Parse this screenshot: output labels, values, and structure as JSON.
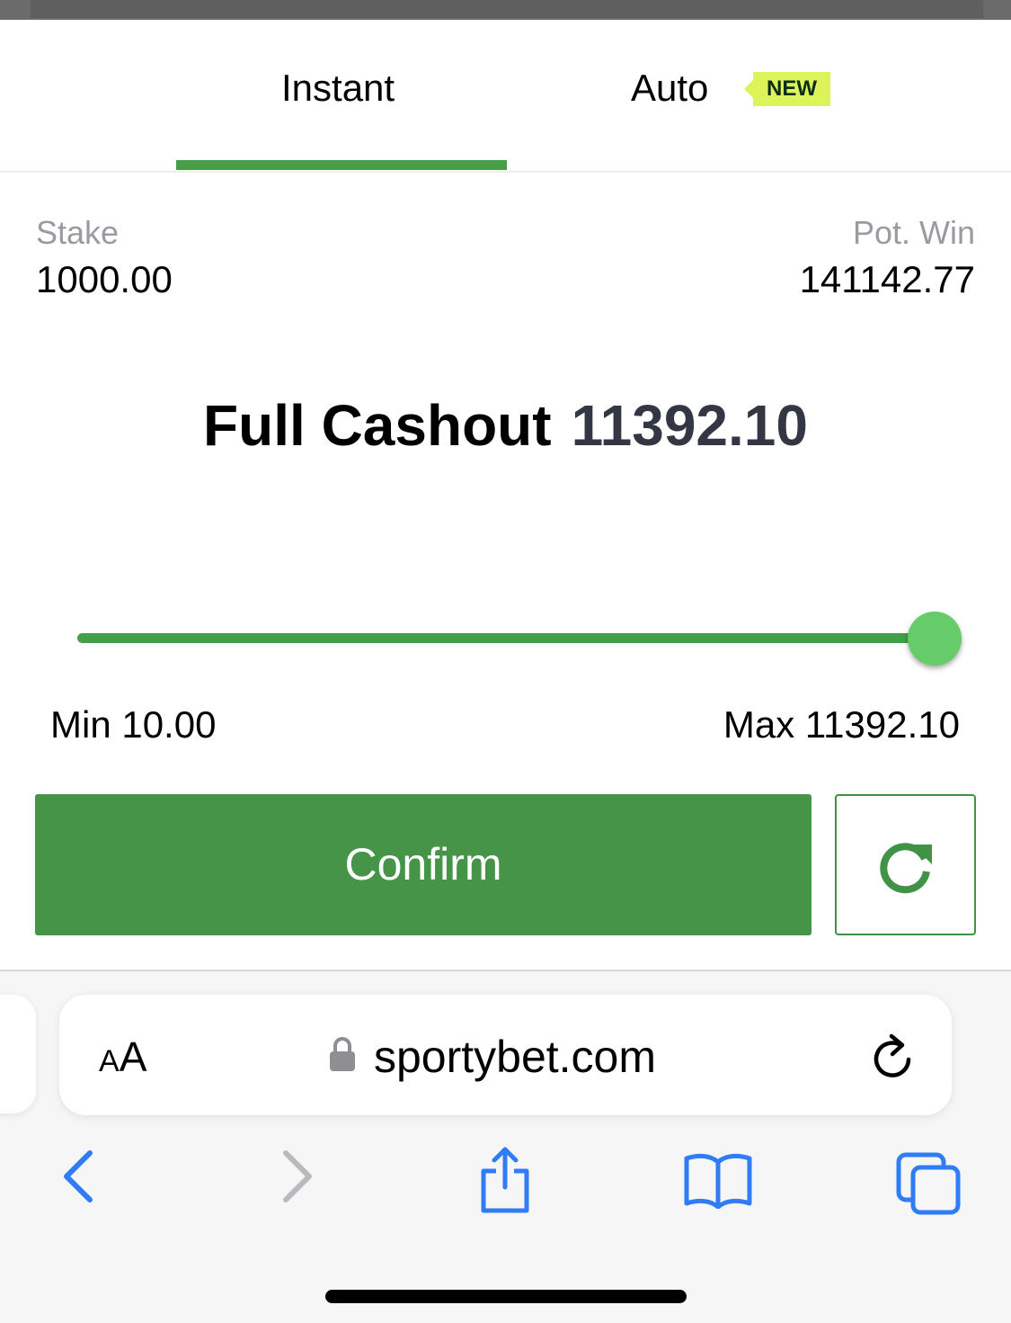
{
  "tabs": {
    "instant": "Instant",
    "auto": "Auto",
    "auto_badge": "NEW",
    "active": "Instant"
  },
  "bet": {
    "stake_label": "Stake",
    "stake_value": "1000.00",
    "potwin_label": "Pot. Win",
    "potwin_value": "141142.77"
  },
  "cashout": {
    "title": "Full Cashout",
    "amount": "11392.10"
  },
  "slider": {
    "min_label": "Min 10.00",
    "max_label": "Max 11392.10",
    "min": 10.0,
    "max": 11392.1,
    "value": 11392.1
  },
  "actions": {
    "confirm_label": "Confirm",
    "refresh_icon": "refresh-icon"
  },
  "browser": {
    "text_size_label_small": "A",
    "text_size_label_big": "A",
    "url": "sportybet.com",
    "icons": [
      "back-icon",
      "forward-icon",
      "share-icon",
      "bookmarks-icon",
      "tabs-icon",
      "lock-icon",
      "reload-icon"
    ]
  },
  "colors": {
    "accent_green": "#43a047",
    "confirm_green": "#469448",
    "knob_green": "#66cc6a",
    "badge_yellow": "#dcf35a",
    "ios_blue": "#2f7cf6"
  }
}
